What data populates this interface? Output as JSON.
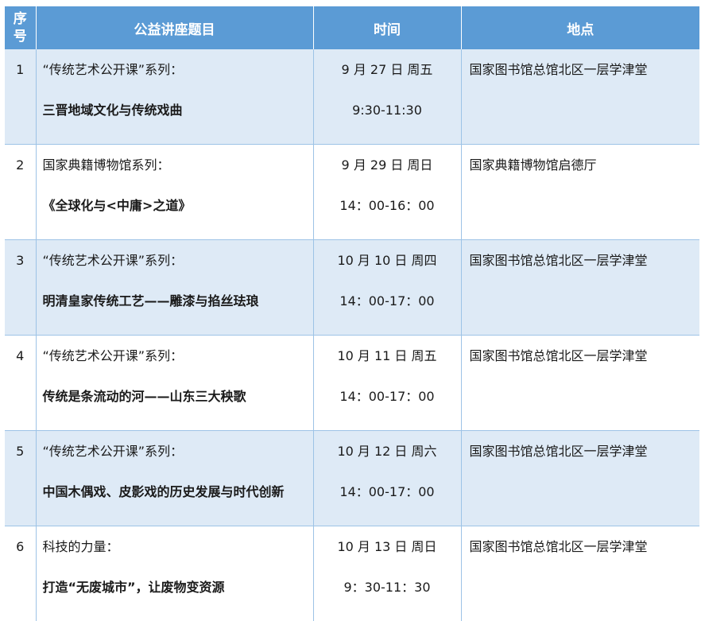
{
  "header": {
    "num_line1": "序",
    "num_line2": "号",
    "title": "公益讲座题目",
    "time": "时间",
    "location": "地点"
  },
  "rows": [
    {
      "num": "1",
      "series": "“传统艺术公开课”系列：",
      "topic": "三晋地域文化与传统戏曲",
      "date": "9 月 27 日 周五",
      "hours": "9:30-11:30",
      "location": "国家图书馆总馆北区一层学津堂"
    },
    {
      "num": "2",
      "series": "国家典籍博物馆系列：",
      "topic": "《全球化与<中庸>之道》",
      "date": "9 月 29 日 周日",
      "hours": "14：00-16：00",
      "location": "国家典籍博物馆启德厅"
    },
    {
      "num": "3",
      "series": "“传统艺术公开课”系列：",
      "topic": "明清皇家传统工艺——雕漆与掐丝珐琅",
      "date": "10 月 10 日 周四",
      "hours": "14：00-17：00",
      "location": "国家图书馆总馆北区一层学津堂"
    },
    {
      "num": "4",
      "series": "“传统艺术公开课”系列：",
      "topic": "传统是条流动的河——山东三大秧歌",
      "date": "10 月 11 日 周五",
      "hours": "14：00-17：00",
      "location": "国家图书馆总馆北区一层学津堂"
    },
    {
      "num": "5",
      "series": "“传统艺术公开课”系列：",
      "topic": "中国木偶戏、皮影戏的历史发展与时代创新",
      "date": "10 月 12 日 周六",
      "hours": "14：00-17：00",
      "location": "国家图书馆总馆北区一层学津堂"
    },
    {
      "num": "6",
      "series": "科技的力量：",
      "topic": "打造“无废城市”，让废物变资源",
      "date": "10 月 13 日 周日",
      "hours": "9：30-11：30",
      "location": "国家图书馆总馆北区一层学津堂"
    }
  ],
  "colors": {
    "header_bg": "#5b9bd5",
    "shaded_row_bg": "#deeaf6",
    "border": "#9dc3e6"
  }
}
